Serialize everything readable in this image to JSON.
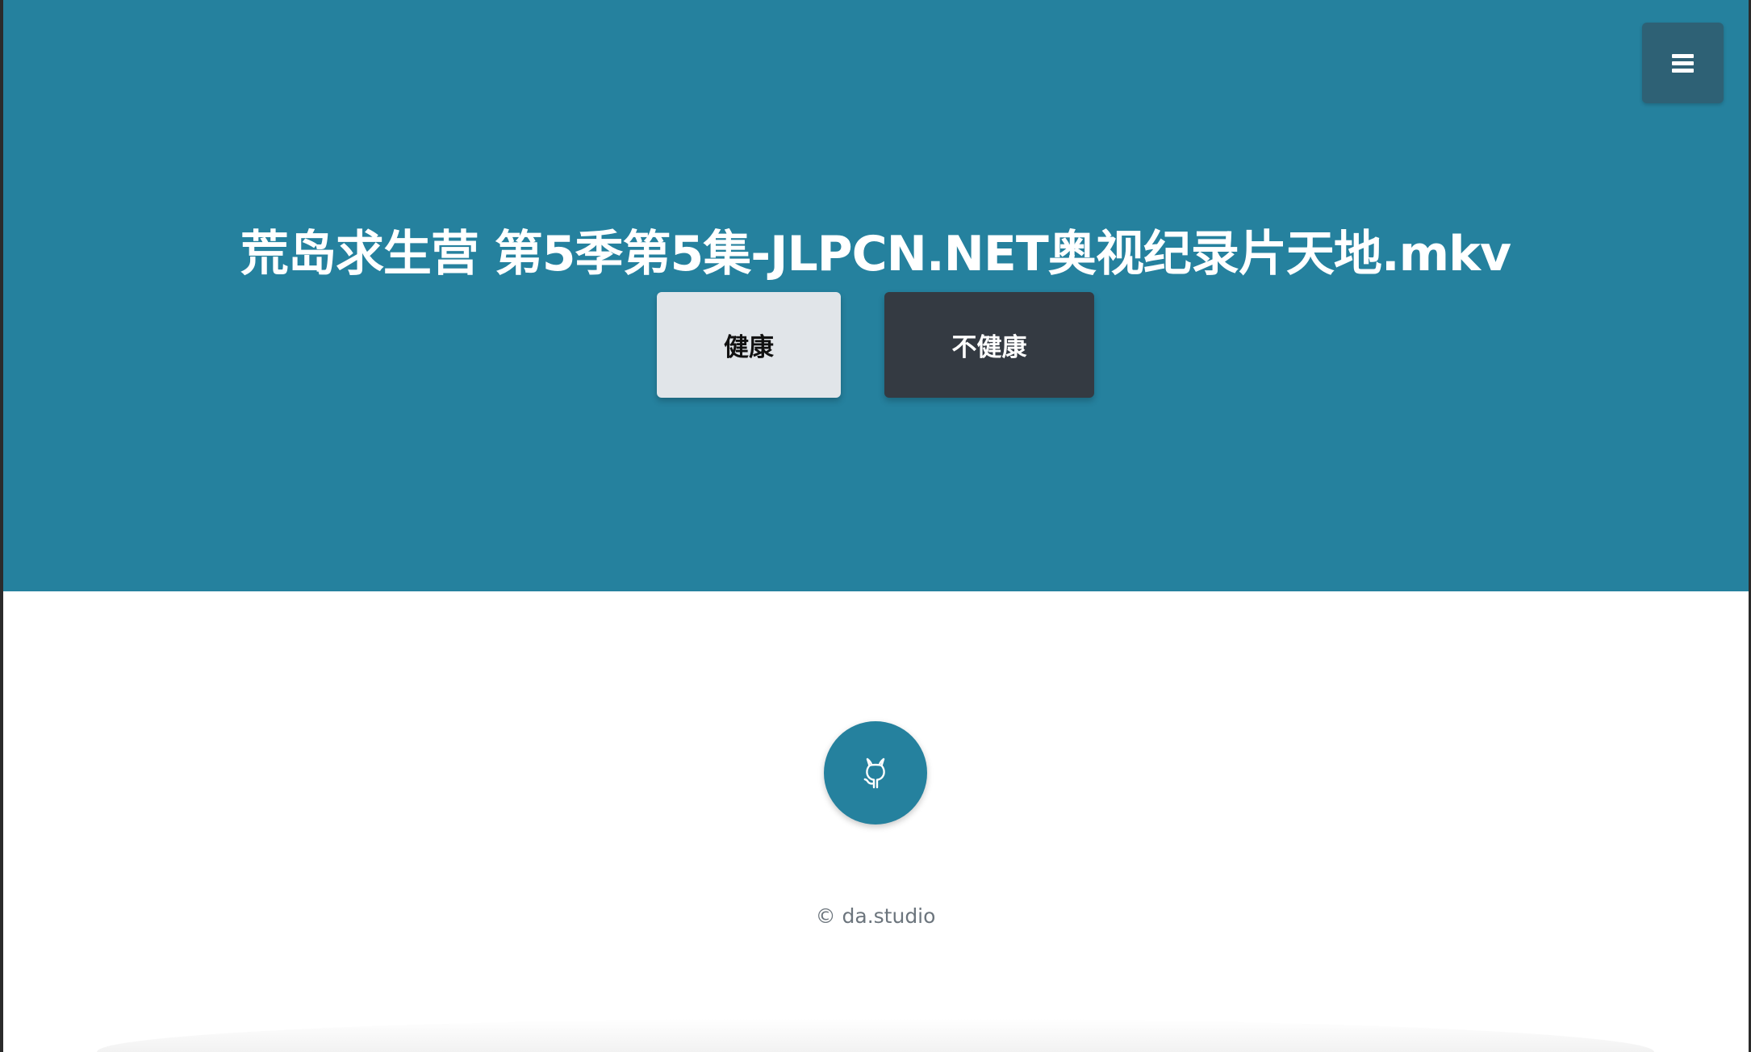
{
  "header": {
    "title": "荒岛求生营 第5季第5集-JLPCN.NET奥视纪录片天地.mkv",
    "menu_icon": "hamburger-menu-icon"
  },
  "actions": {
    "healthy_label": "健康",
    "unhealthy_label": "不健康"
  },
  "footer": {
    "github_icon": "github-icon",
    "copyright": "© da.studio"
  },
  "colors": {
    "brand": "#25819e",
    "menu_button": "#2e6175",
    "healthy_button": "#e1e5e9",
    "unhealthy_button": "#343a42",
    "footer_text": "#6c757d"
  }
}
